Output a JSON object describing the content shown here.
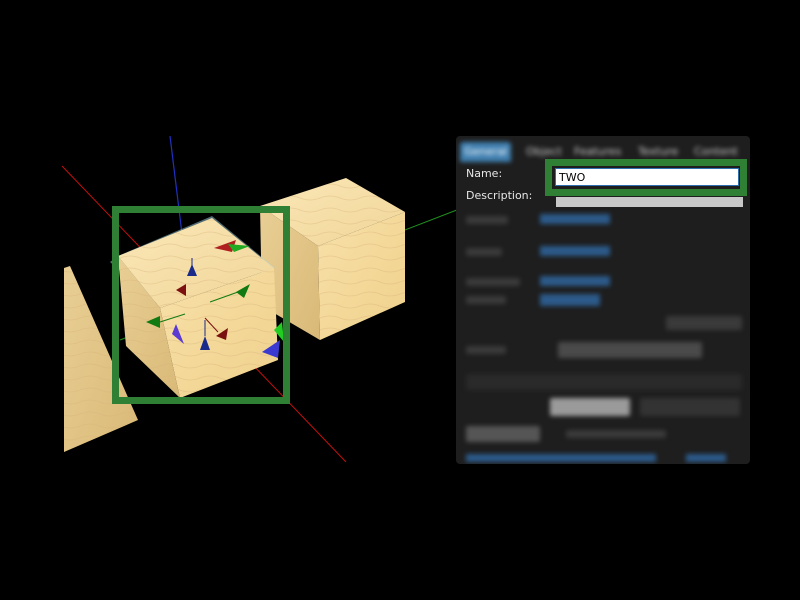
{
  "viewport": {
    "background": "#000000",
    "objects": [
      "wood-cube-left",
      "wood-cube-selected",
      "wood-cube-right"
    ],
    "axis_colors": {
      "x": "#c01010",
      "y": "#209020",
      "z": "#2030c0"
    }
  },
  "highlight_color": "#2f7f35",
  "build_panel": {
    "tabs": [
      "General",
      "Object",
      "Features",
      "Texture",
      "Content"
    ],
    "active_tab": "General",
    "name_label": "Name:",
    "name_value": "TWO",
    "description_label": "Description:"
  }
}
